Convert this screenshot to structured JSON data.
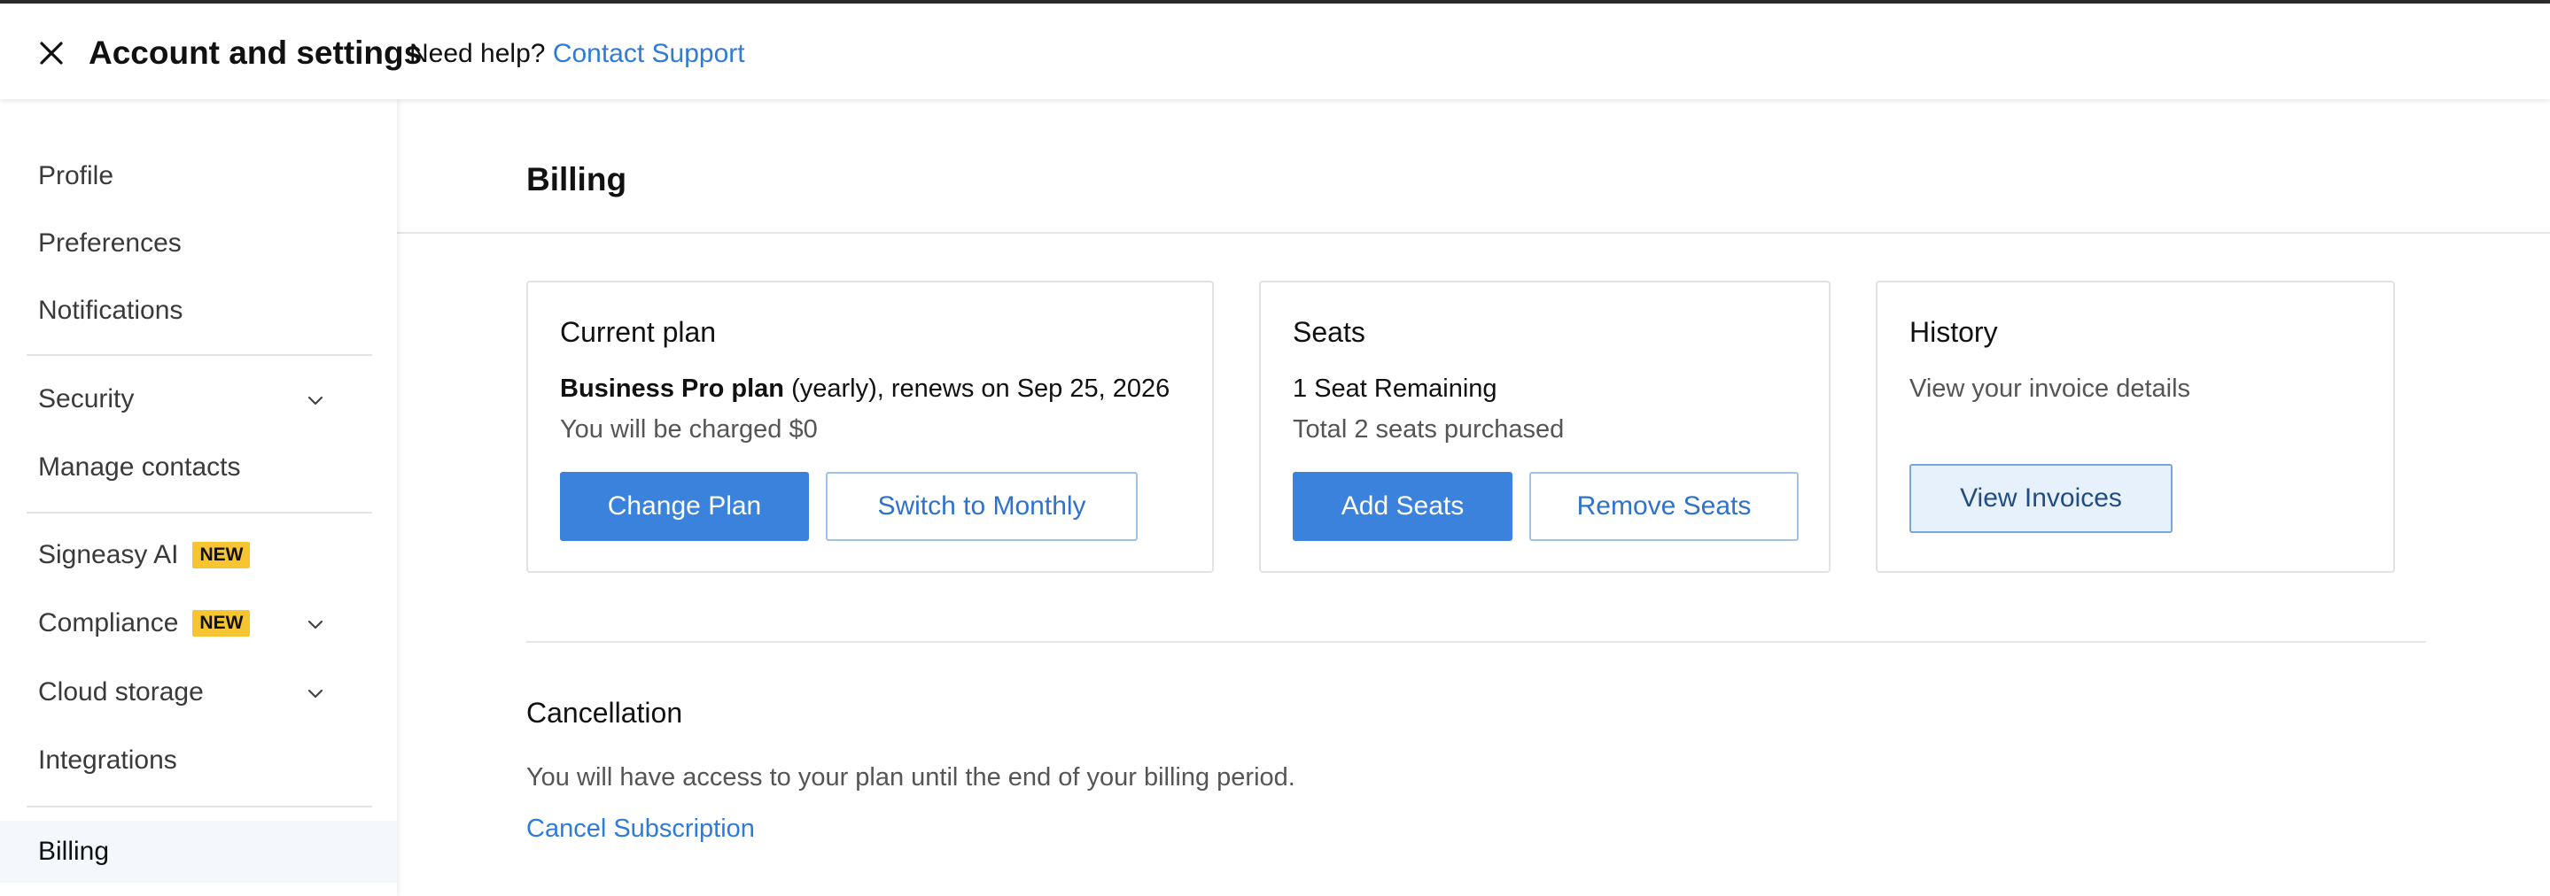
{
  "header": {
    "title": "Account and settings",
    "help_prefix": "Need help?",
    "help_link": "Contact Support",
    "close_icon": "close-icon"
  },
  "sidebar": {
    "items": [
      {
        "label": "Profile"
      },
      {
        "label": "Preferences"
      },
      {
        "label": "Notifications"
      },
      {
        "label": "Security",
        "icon": "chevron-down-icon"
      },
      {
        "label": "Manage contacts"
      },
      {
        "label": "Signeasy AI",
        "badge": "NEW"
      },
      {
        "label": "Compliance",
        "badge": "NEW",
        "icon": "chevron-down-icon"
      },
      {
        "label": "Cloud storage",
        "icon": "chevron-down-icon"
      },
      {
        "label": "Integrations"
      },
      {
        "label": "Billing",
        "active": true
      }
    ]
  },
  "main": {
    "title": "Billing",
    "current_plan": {
      "title": "Current plan",
      "plan_name": "Business Pro plan",
      "plan_detail": " (yearly), renews on Sep 25, 2026",
      "charge": "You will be charged $0",
      "primary_button": "Change Plan",
      "secondary_button": "Switch to Monthly"
    },
    "seats": {
      "title": "Seats",
      "remaining": "1 Seat Remaining",
      "total": "Total 2 seats purchased",
      "primary_button": "Add Seats",
      "secondary_button": "Remove Seats"
    },
    "history": {
      "title": "History",
      "description": "View your invoice details",
      "button": "View Invoices"
    },
    "cancellation": {
      "title": "Cancellation",
      "description": "You will have access to your plan until the end of your billing period.",
      "link": "Cancel Subscription"
    }
  },
  "colors": {
    "accent": "#3a82dc",
    "link": "#2f7bd8",
    "badge": "#f6c531"
  }
}
